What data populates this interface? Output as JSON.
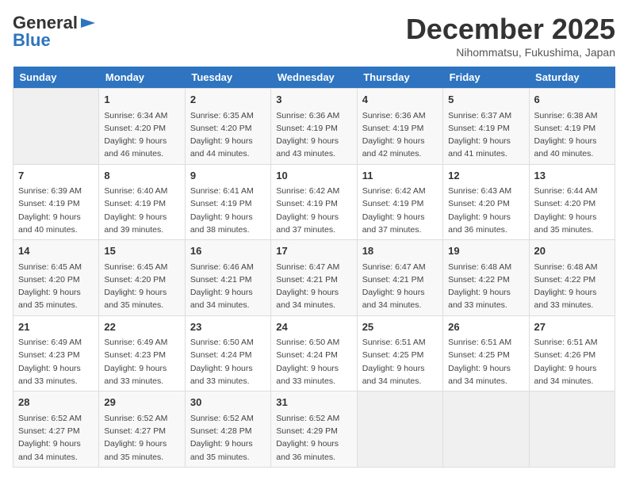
{
  "logo": {
    "general": "General",
    "blue": "Blue",
    "arrow_symbol": "▶"
  },
  "title": "December 2025",
  "location": "Nihommatsu, Fukushima, Japan",
  "days_of_week": [
    "Sunday",
    "Monday",
    "Tuesday",
    "Wednesday",
    "Thursday",
    "Friday",
    "Saturday"
  ],
  "weeks": [
    [
      {
        "day": "",
        "info": ""
      },
      {
        "day": "1",
        "info": "Sunrise: 6:34 AM\nSunset: 4:20 PM\nDaylight: 9 hours\nand 46 minutes."
      },
      {
        "day": "2",
        "info": "Sunrise: 6:35 AM\nSunset: 4:20 PM\nDaylight: 9 hours\nand 44 minutes."
      },
      {
        "day": "3",
        "info": "Sunrise: 6:36 AM\nSunset: 4:19 PM\nDaylight: 9 hours\nand 43 minutes."
      },
      {
        "day": "4",
        "info": "Sunrise: 6:36 AM\nSunset: 4:19 PM\nDaylight: 9 hours\nand 42 minutes."
      },
      {
        "day": "5",
        "info": "Sunrise: 6:37 AM\nSunset: 4:19 PM\nDaylight: 9 hours\nand 41 minutes."
      },
      {
        "day": "6",
        "info": "Sunrise: 6:38 AM\nSunset: 4:19 PM\nDaylight: 9 hours\nand 40 minutes."
      }
    ],
    [
      {
        "day": "7",
        "info": "Sunrise: 6:39 AM\nSunset: 4:19 PM\nDaylight: 9 hours\nand 40 minutes."
      },
      {
        "day": "8",
        "info": "Sunrise: 6:40 AM\nSunset: 4:19 PM\nDaylight: 9 hours\nand 39 minutes."
      },
      {
        "day": "9",
        "info": "Sunrise: 6:41 AM\nSunset: 4:19 PM\nDaylight: 9 hours\nand 38 minutes."
      },
      {
        "day": "10",
        "info": "Sunrise: 6:42 AM\nSunset: 4:19 PM\nDaylight: 9 hours\nand 37 minutes."
      },
      {
        "day": "11",
        "info": "Sunrise: 6:42 AM\nSunset: 4:19 PM\nDaylight: 9 hours\nand 37 minutes."
      },
      {
        "day": "12",
        "info": "Sunrise: 6:43 AM\nSunset: 4:20 PM\nDaylight: 9 hours\nand 36 minutes."
      },
      {
        "day": "13",
        "info": "Sunrise: 6:44 AM\nSunset: 4:20 PM\nDaylight: 9 hours\nand 35 minutes."
      }
    ],
    [
      {
        "day": "14",
        "info": "Sunrise: 6:45 AM\nSunset: 4:20 PM\nDaylight: 9 hours\nand 35 minutes."
      },
      {
        "day": "15",
        "info": "Sunrise: 6:45 AM\nSunset: 4:20 PM\nDaylight: 9 hours\nand 35 minutes."
      },
      {
        "day": "16",
        "info": "Sunrise: 6:46 AM\nSunset: 4:21 PM\nDaylight: 9 hours\nand 34 minutes."
      },
      {
        "day": "17",
        "info": "Sunrise: 6:47 AM\nSunset: 4:21 PM\nDaylight: 9 hours\nand 34 minutes."
      },
      {
        "day": "18",
        "info": "Sunrise: 6:47 AM\nSunset: 4:21 PM\nDaylight: 9 hours\nand 34 minutes."
      },
      {
        "day": "19",
        "info": "Sunrise: 6:48 AM\nSunset: 4:22 PM\nDaylight: 9 hours\nand 33 minutes."
      },
      {
        "day": "20",
        "info": "Sunrise: 6:48 AM\nSunset: 4:22 PM\nDaylight: 9 hours\nand 33 minutes."
      }
    ],
    [
      {
        "day": "21",
        "info": "Sunrise: 6:49 AM\nSunset: 4:23 PM\nDaylight: 9 hours\nand 33 minutes."
      },
      {
        "day": "22",
        "info": "Sunrise: 6:49 AM\nSunset: 4:23 PM\nDaylight: 9 hours\nand 33 minutes."
      },
      {
        "day": "23",
        "info": "Sunrise: 6:50 AM\nSunset: 4:24 PM\nDaylight: 9 hours\nand 33 minutes."
      },
      {
        "day": "24",
        "info": "Sunrise: 6:50 AM\nSunset: 4:24 PM\nDaylight: 9 hours\nand 33 minutes."
      },
      {
        "day": "25",
        "info": "Sunrise: 6:51 AM\nSunset: 4:25 PM\nDaylight: 9 hours\nand 34 minutes."
      },
      {
        "day": "26",
        "info": "Sunrise: 6:51 AM\nSunset: 4:25 PM\nDaylight: 9 hours\nand 34 minutes."
      },
      {
        "day": "27",
        "info": "Sunrise: 6:51 AM\nSunset: 4:26 PM\nDaylight: 9 hours\nand 34 minutes."
      }
    ],
    [
      {
        "day": "28",
        "info": "Sunrise: 6:52 AM\nSunset: 4:27 PM\nDaylight: 9 hours\nand 34 minutes."
      },
      {
        "day": "29",
        "info": "Sunrise: 6:52 AM\nSunset: 4:27 PM\nDaylight: 9 hours\nand 35 minutes."
      },
      {
        "day": "30",
        "info": "Sunrise: 6:52 AM\nSunset: 4:28 PM\nDaylight: 9 hours\nand 35 minutes."
      },
      {
        "day": "31",
        "info": "Sunrise: 6:52 AM\nSunset: 4:29 PM\nDaylight: 9 hours\nand 36 minutes."
      },
      {
        "day": "",
        "info": ""
      },
      {
        "day": "",
        "info": ""
      },
      {
        "day": "",
        "info": ""
      }
    ]
  ]
}
